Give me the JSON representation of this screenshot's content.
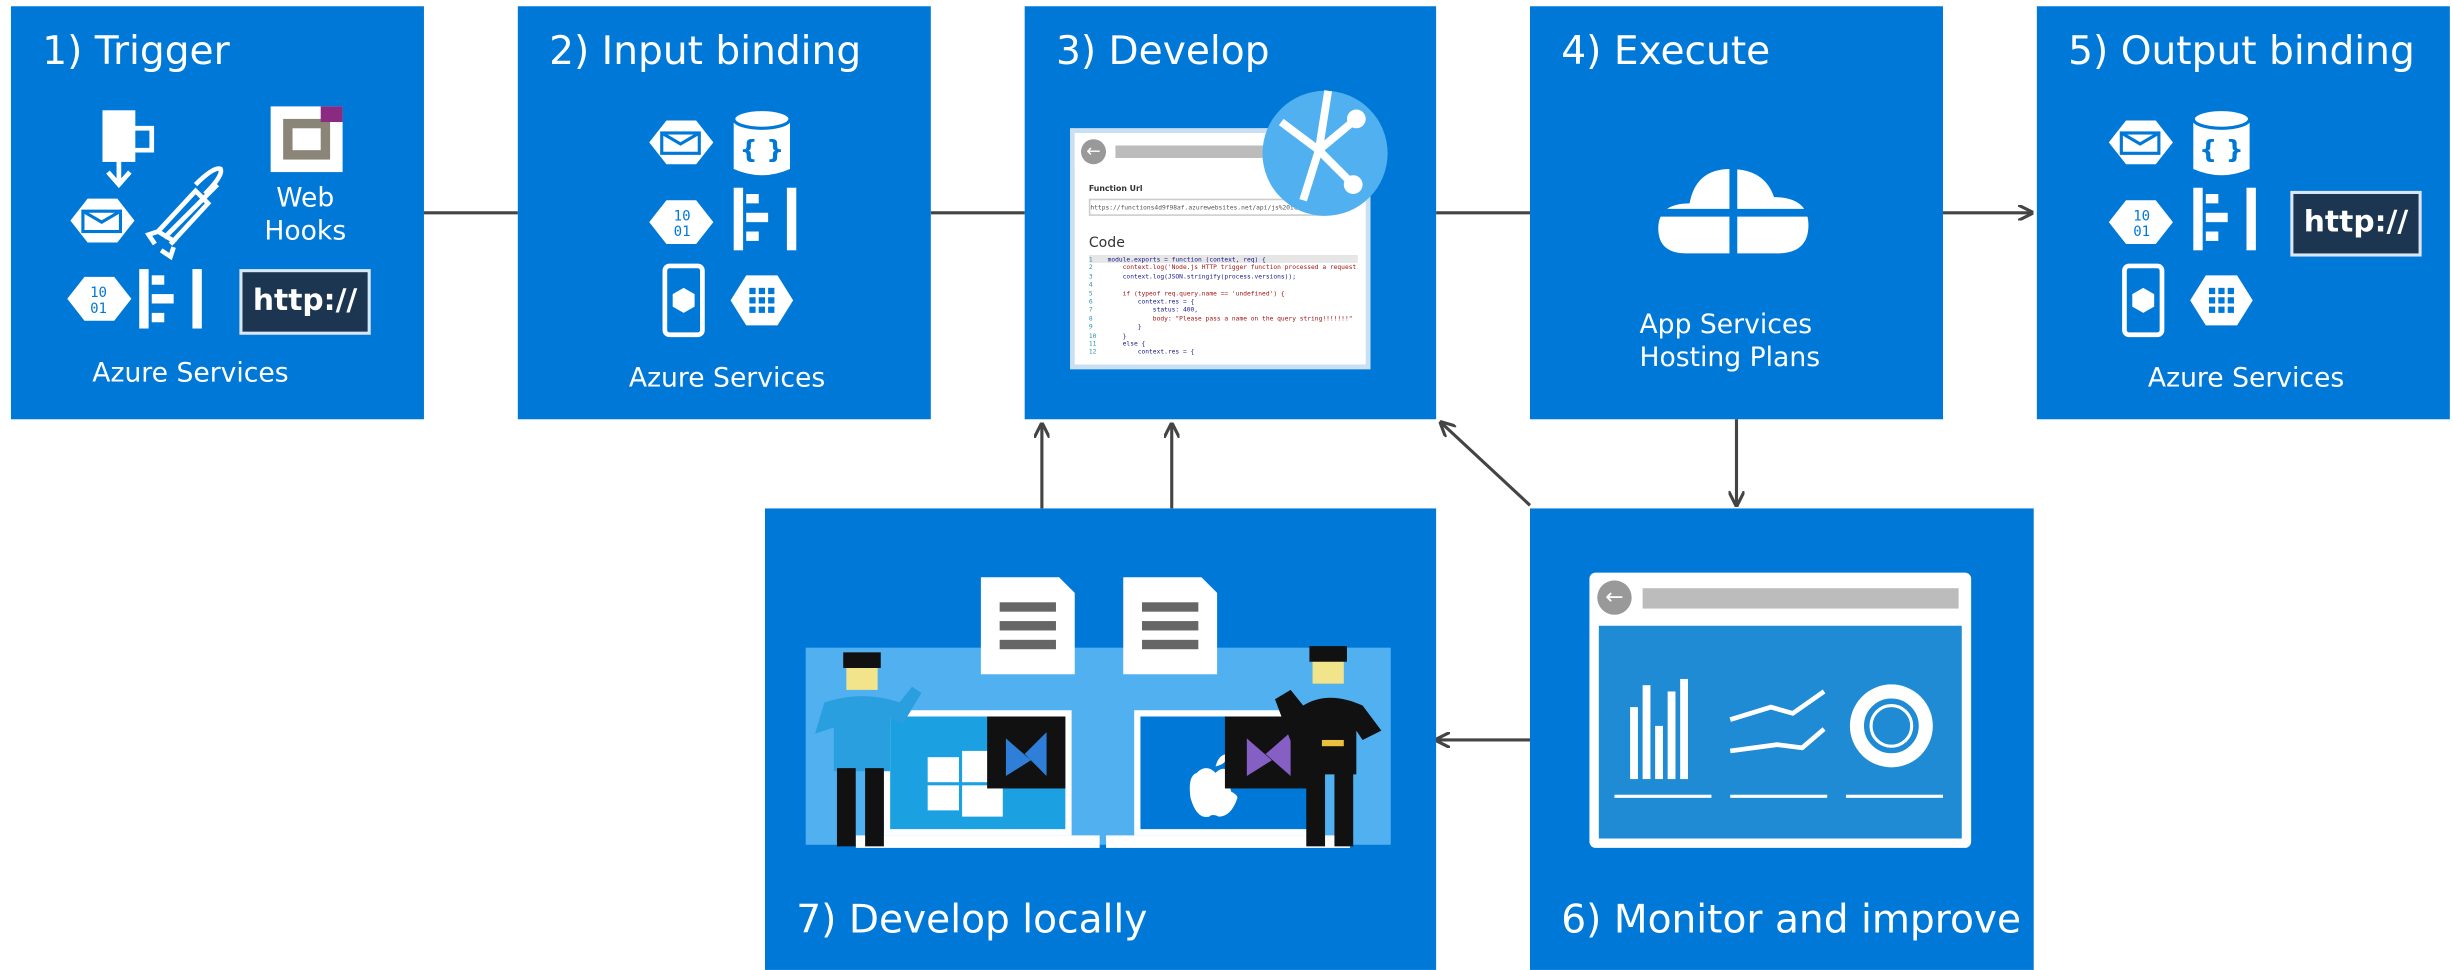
{
  "steps": {
    "trigger": {
      "title": "1) Trigger",
      "web_hooks_line1": "Web",
      "web_hooks_line2": "Hooks",
      "http": "http://",
      "caption": "Azure Services"
    },
    "input_binding": {
      "title": "2) Input binding",
      "caption": "Azure Services"
    },
    "develop": {
      "title": "3) Develop",
      "function_url_label": "Function Url",
      "function_url_value": "https://functions4d9f98af.azurewebsites.net/api/js%20icon",
      "code_label": "Code",
      "code_lines": [
        "module.exports = function (context, req) {",
        "    context.log('Node.js HTTP trigger function processed a request.",
        "    context.log(JSON.stringify(process.versions));",
        "",
        "    if (typeof req.query.name == 'undefined') {",
        "        context.res = {",
        "            status: 400,",
        "            body: \"Please pass a name on the query string!!!!!!!\"",
        "        }",
        "    }",
        "    else {",
        "        context.res = {"
      ],
      "line_numbers": [
        "1",
        "2",
        "3",
        "4",
        "5",
        "6",
        "7",
        "8",
        "9",
        "10",
        "11",
        "12"
      ]
    },
    "execute": {
      "title": "4) Execute",
      "caption_line1": "App Services",
      "caption_line2": "Hosting Plans"
    },
    "output_binding": {
      "title": "5) Output binding",
      "http": "http://",
      "caption": "Azure Services"
    },
    "monitor": {
      "title": "6) Monitor and improve"
    },
    "develop_locally": {
      "title": "7) Develop locally"
    }
  },
  "colors": {
    "box": "#0078d7",
    "light_blue": "#50b0f0",
    "arrow": "#444444",
    "hex_icon": "#ffffff",
    "panel": "#1e8bd4"
  },
  "icons": {
    "trigger": [
      "function-download-icon",
      "queue-message-icon",
      "rocket-icon",
      "binary-data-icon",
      "event-hub-icon",
      "webhook-logo-icon"
    ],
    "input_binding": [
      "queue-message-icon",
      "json-database-icon",
      "binary-data-icon",
      "event-hub-icon",
      "mobile-app-icon",
      "table-grid-icon"
    ],
    "output_binding": [
      "queue-message-icon",
      "json-database-icon",
      "binary-data-icon",
      "event-hub-icon",
      "mobile-app-icon",
      "table-grid-icon"
    ]
  }
}
